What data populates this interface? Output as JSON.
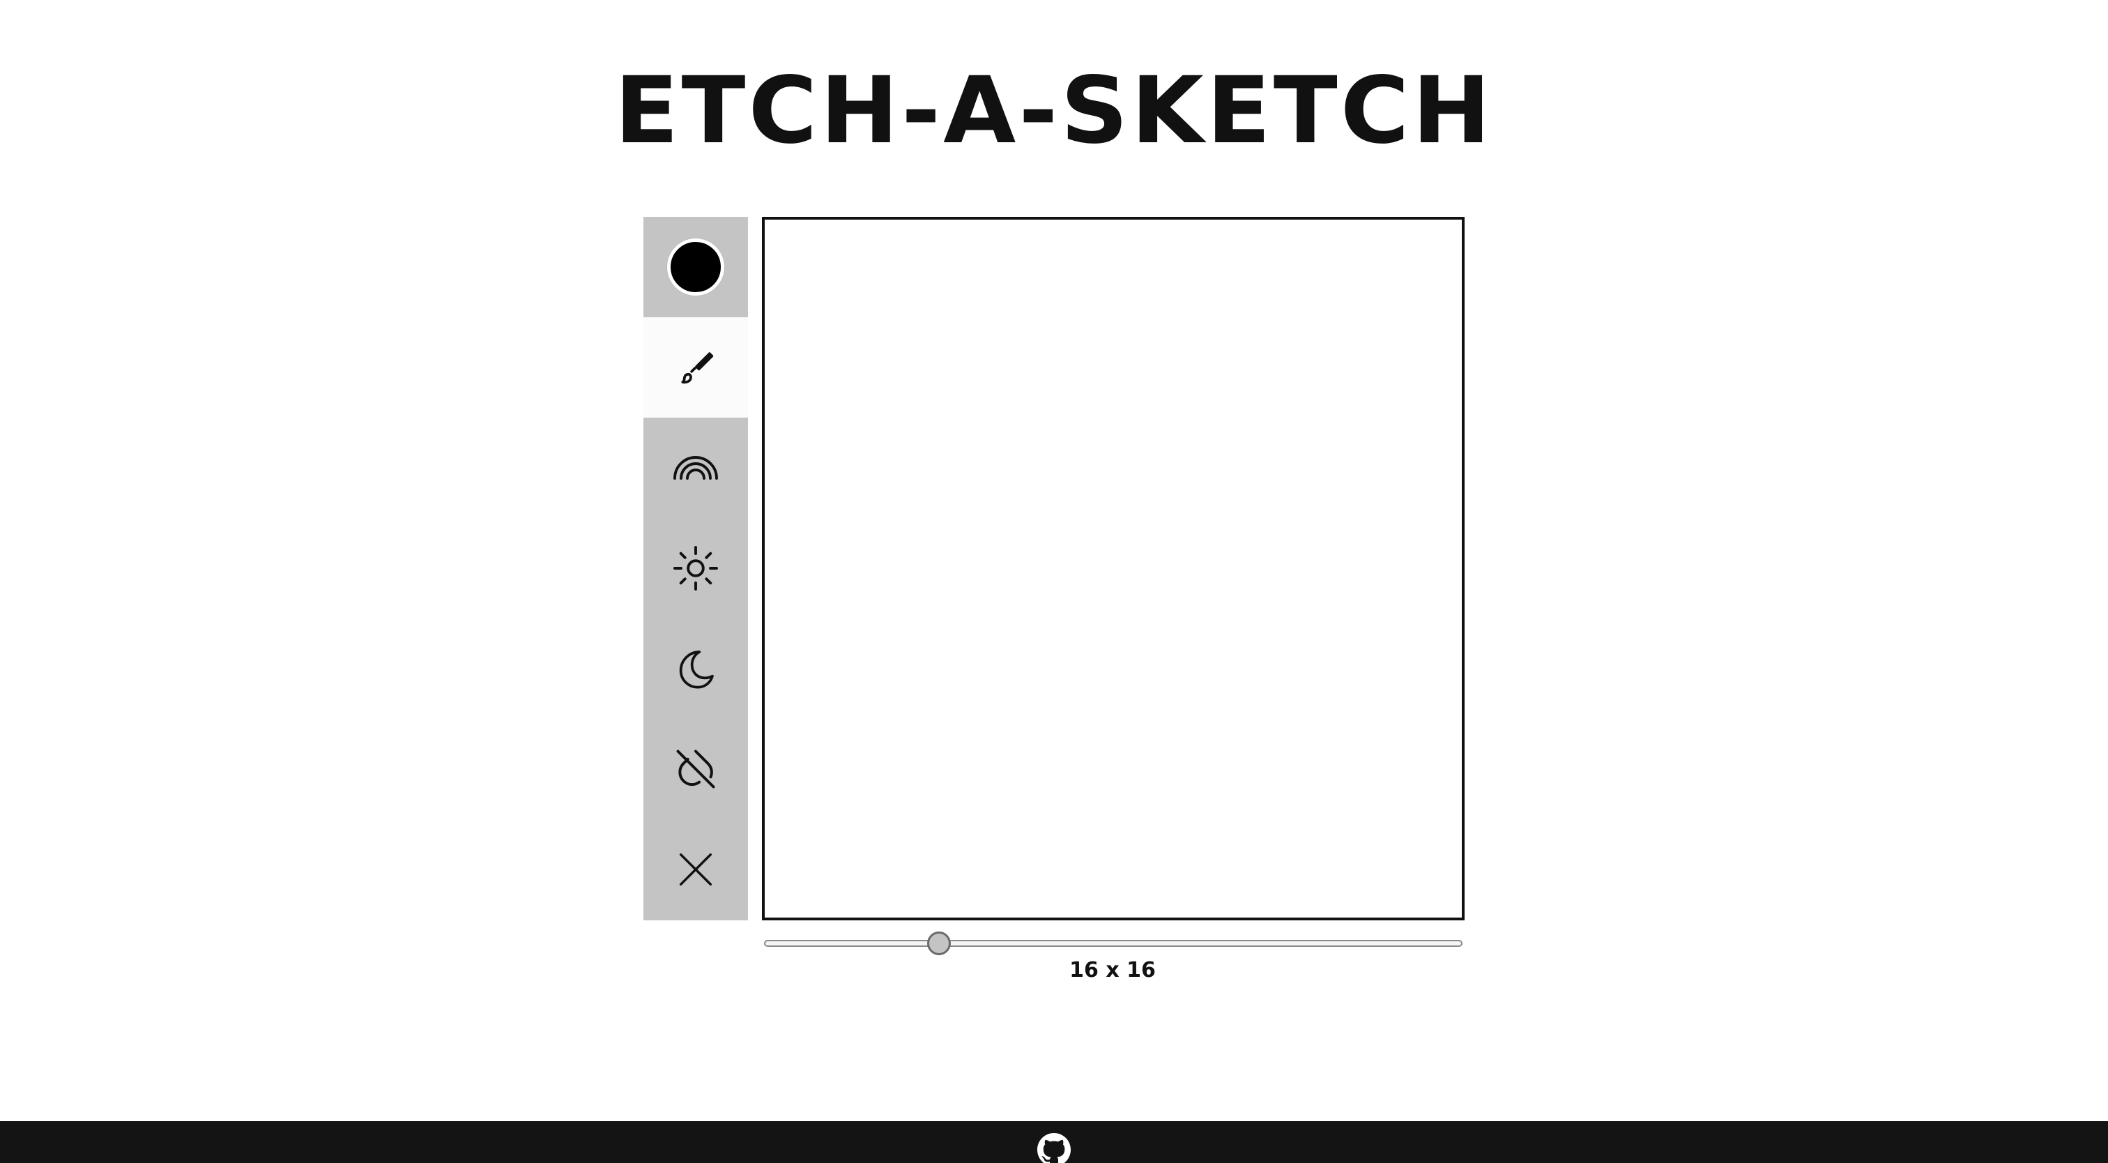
{
  "header": {
    "title": "ETCH-A-SKETCH"
  },
  "toolbar": {
    "tools": [
      {
        "name": "color-picker",
        "icon": "color-swatch",
        "active": false
      },
      {
        "name": "brush",
        "icon": "brush-icon",
        "active": true
      },
      {
        "name": "rainbow",
        "icon": "rainbow-icon",
        "active": false
      },
      {
        "name": "lighten",
        "icon": "sun-icon",
        "active": false
      },
      {
        "name": "darken",
        "icon": "moon-icon",
        "active": false
      },
      {
        "name": "eraser",
        "icon": "no-color-icon",
        "active": false
      },
      {
        "name": "clear",
        "icon": "close-icon",
        "active": false
      }
    ],
    "current_color": "#000000"
  },
  "grid": {
    "size_label": "16 x 16",
    "size": 16,
    "slider_fraction": 0.25
  },
  "footer": {
    "icon": "github-icon"
  },
  "colors": {
    "sidebar_bg": "#c4c4c4",
    "active_tool_bg": "#fbfbfb",
    "footer_bg": "#141414",
    "text": "#111111"
  }
}
